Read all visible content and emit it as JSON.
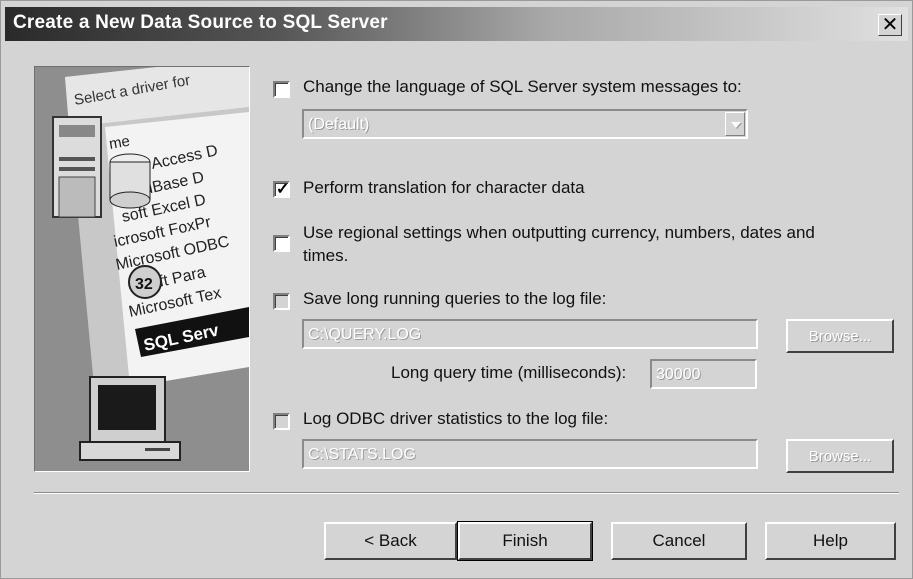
{
  "window": {
    "title": "Create a New Data Source to SQL Server",
    "close_glyph": "✕"
  },
  "art": {
    "lines": [
      "Select a driver for",
      "me",
      "osoft Access D",
      "oft dBase D",
      "soft Excel D",
      "icrosoft FoxPr",
      "Microsoft ODBC",
      "osoft Para",
      "Microsoft Tex",
      "SQL Serv"
    ],
    "badge": "32"
  },
  "options": {
    "change_language": {
      "label": "Change the language of SQL Server system messages to:",
      "checked": false
    },
    "language_select": {
      "value": "(Default)"
    },
    "perform_translation": {
      "label": "Perform translation for character data",
      "checked": true,
      "check_glyph": "✓"
    },
    "regional_settings": {
      "label_line1": "Use regional settings when outputting currency, numbers, dates and",
      "label_line2": "times.",
      "checked": false
    },
    "save_long_queries": {
      "label": "Save long running queries to the log file:",
      "checked": false
    },
    "query_log_path": {
      "value": "C:\\QUERY.LOG"
    },
    "query_browse": {
      "label": "Browse..."
    },
    "long_query_time": {
      "label": "Long query time (milliseconds):",
      "value": "30000"
    },
    "log_stats": {
      "label": "Log ODBC driver statistics to the log file:",
      "checked": false
    },
    "stats_log_path": {
      "value": "C:\\STATS.LOG"
    },
    "stats_browse": {
      "label": "Browse..."
    }
  },
  "buttons": {
    "back": "< Back",
    "finish": "Finish",
    "cancel": "Cancel",
    "help": "Help"
  }
}
